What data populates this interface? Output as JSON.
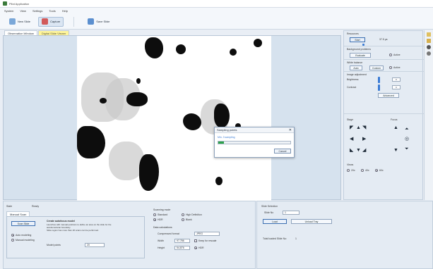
{
  "window": {
    "title": "Pilot Application"
  },
  "menu": [
    "System",
    "View",
    "Settings",
    "Tools",
    "Help"
  ],
  "toolbar": {
    "new_slide": "New Slide",
    "capture": "Capture",
    "save_slide": "Save Slide"
  },
  "tabs": [
    "Observation Window",
    "Digital Slide Viewer"
  ],
  "dialog": {
    "title": "Sampling points",
    "status": "Min. 3 sampling",
    "progress": 0.08,
    "cancel": "Cancel"
  },
  "right_panel": {
    "resources_title": "Resources",
    "resources_btn": "Start",
    "resources_value": "37.5 µs",
    "background_title": "Background problems",
    "evaluate_btn": "Evaluate",
    "active_label": "Active",
    "white_balance_title": "White balance",
    "auto_btn": "Auto",
    "custom_btn": "Custom",
    "active_label2": "Active",
    "image_adjust_title": "Image adjustment",
    "brightness_label": "Brightness",
    "brightness_value": "0",
    "contrast_label": "Contrast",
    "contrast_value": "0",
    "advanced_btn": "Advanced",
    "stage_title": "Stage",
    "focus_title": "Focus",
    "views_title": "Views",
    "views": [
      "20x",
      "40x",
      "60x"
    ]
  },
  "bottom_left": {
    "state_label": "State",
    "state_value": "Ready",
    "manual_tab": "Manual Scan",
    "scan_btn": "Scan Slide",
    "create_title": "Create autofocus model",
    "create_desc_1": "Launches with manual positions to define an area on the slide for the",
    "create_desc_2": "autofocus/scan boundary.",
    "create_desc_3": "Slide region has more than 20 scans can be performed.",
    "auto_model": "Auto modeling",
    "manual_model": "Manual modeling",
    "model_points_label": "Model points",
    "model_points_value": "20",
    "scanning_mode_title": "Scanning mode",
    "mode_standard": "Standard",
    "mode_high": "High Definition",
    "mode_hdr": "HDR",
    "mode_blank": "Blank",
    "data_title": "Data calculations",
    "compressed_label": "Compressed format",
    "compressed_value": "JPEG",
    "width_label": "Width",
    "width_value": "97,786",
    "keep_ratio": "Keep for rescale",
    "height_label": "Height",
    "height_value": "54,876",
    "hdr_label": "HDR"
  },
  "bottom_right": {
    "title": "Slide Selection",
    "slide_no_label": "Slide No",
    "slide_no_value": "1",
    "load_btn": "Load",
    "unload_btn": "Unload Tray",
    "total_label": "Total loaded Slide No:",
    "total_value": "1"
  },
  "colors": {
    "accent": "#3a7bd5",
    "progress": "#2ca24a",
    "highlight_tab": "#fff59a"
  }
}
